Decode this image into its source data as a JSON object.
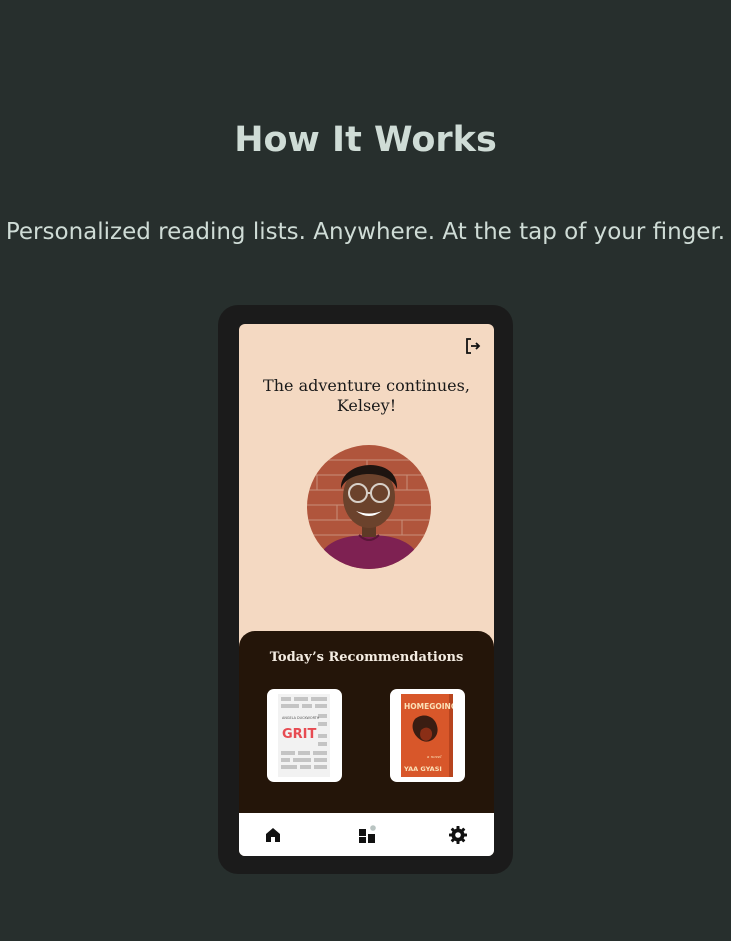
{
  "section": {
    "title": "How It Works",
    "subtitle": "Personalized reading lists. Anywhere. At the tap of your finger."
  },
  "app": {
    "greeting_line1": "The adventure continues,",
    "greeting_line2": "Kelsey!",
    "recommendations_title": "Today’s Recommendations",
    "books": [
      {
        "cover_author": "ANGELA DUCKWORTH",
        "cover_title": "GRIT",
        "cover_color": "#e74b52"
      },
      {
        "cover_title": "HOMEGOING",
        "cover_tag": "a novel",
        "cover_author": "YAA GYASI",
        "cover_color": "#d8572a"
      }
    ],
    "nav": [
      "home-icon",
      "library-icon",
      "settings-icon"
    ],
    "colors": {
      "page_background": "#272f2d",
      "screen_background": "#f4d9c2",
      "panel_background": "#241509"
    }
  }
}
